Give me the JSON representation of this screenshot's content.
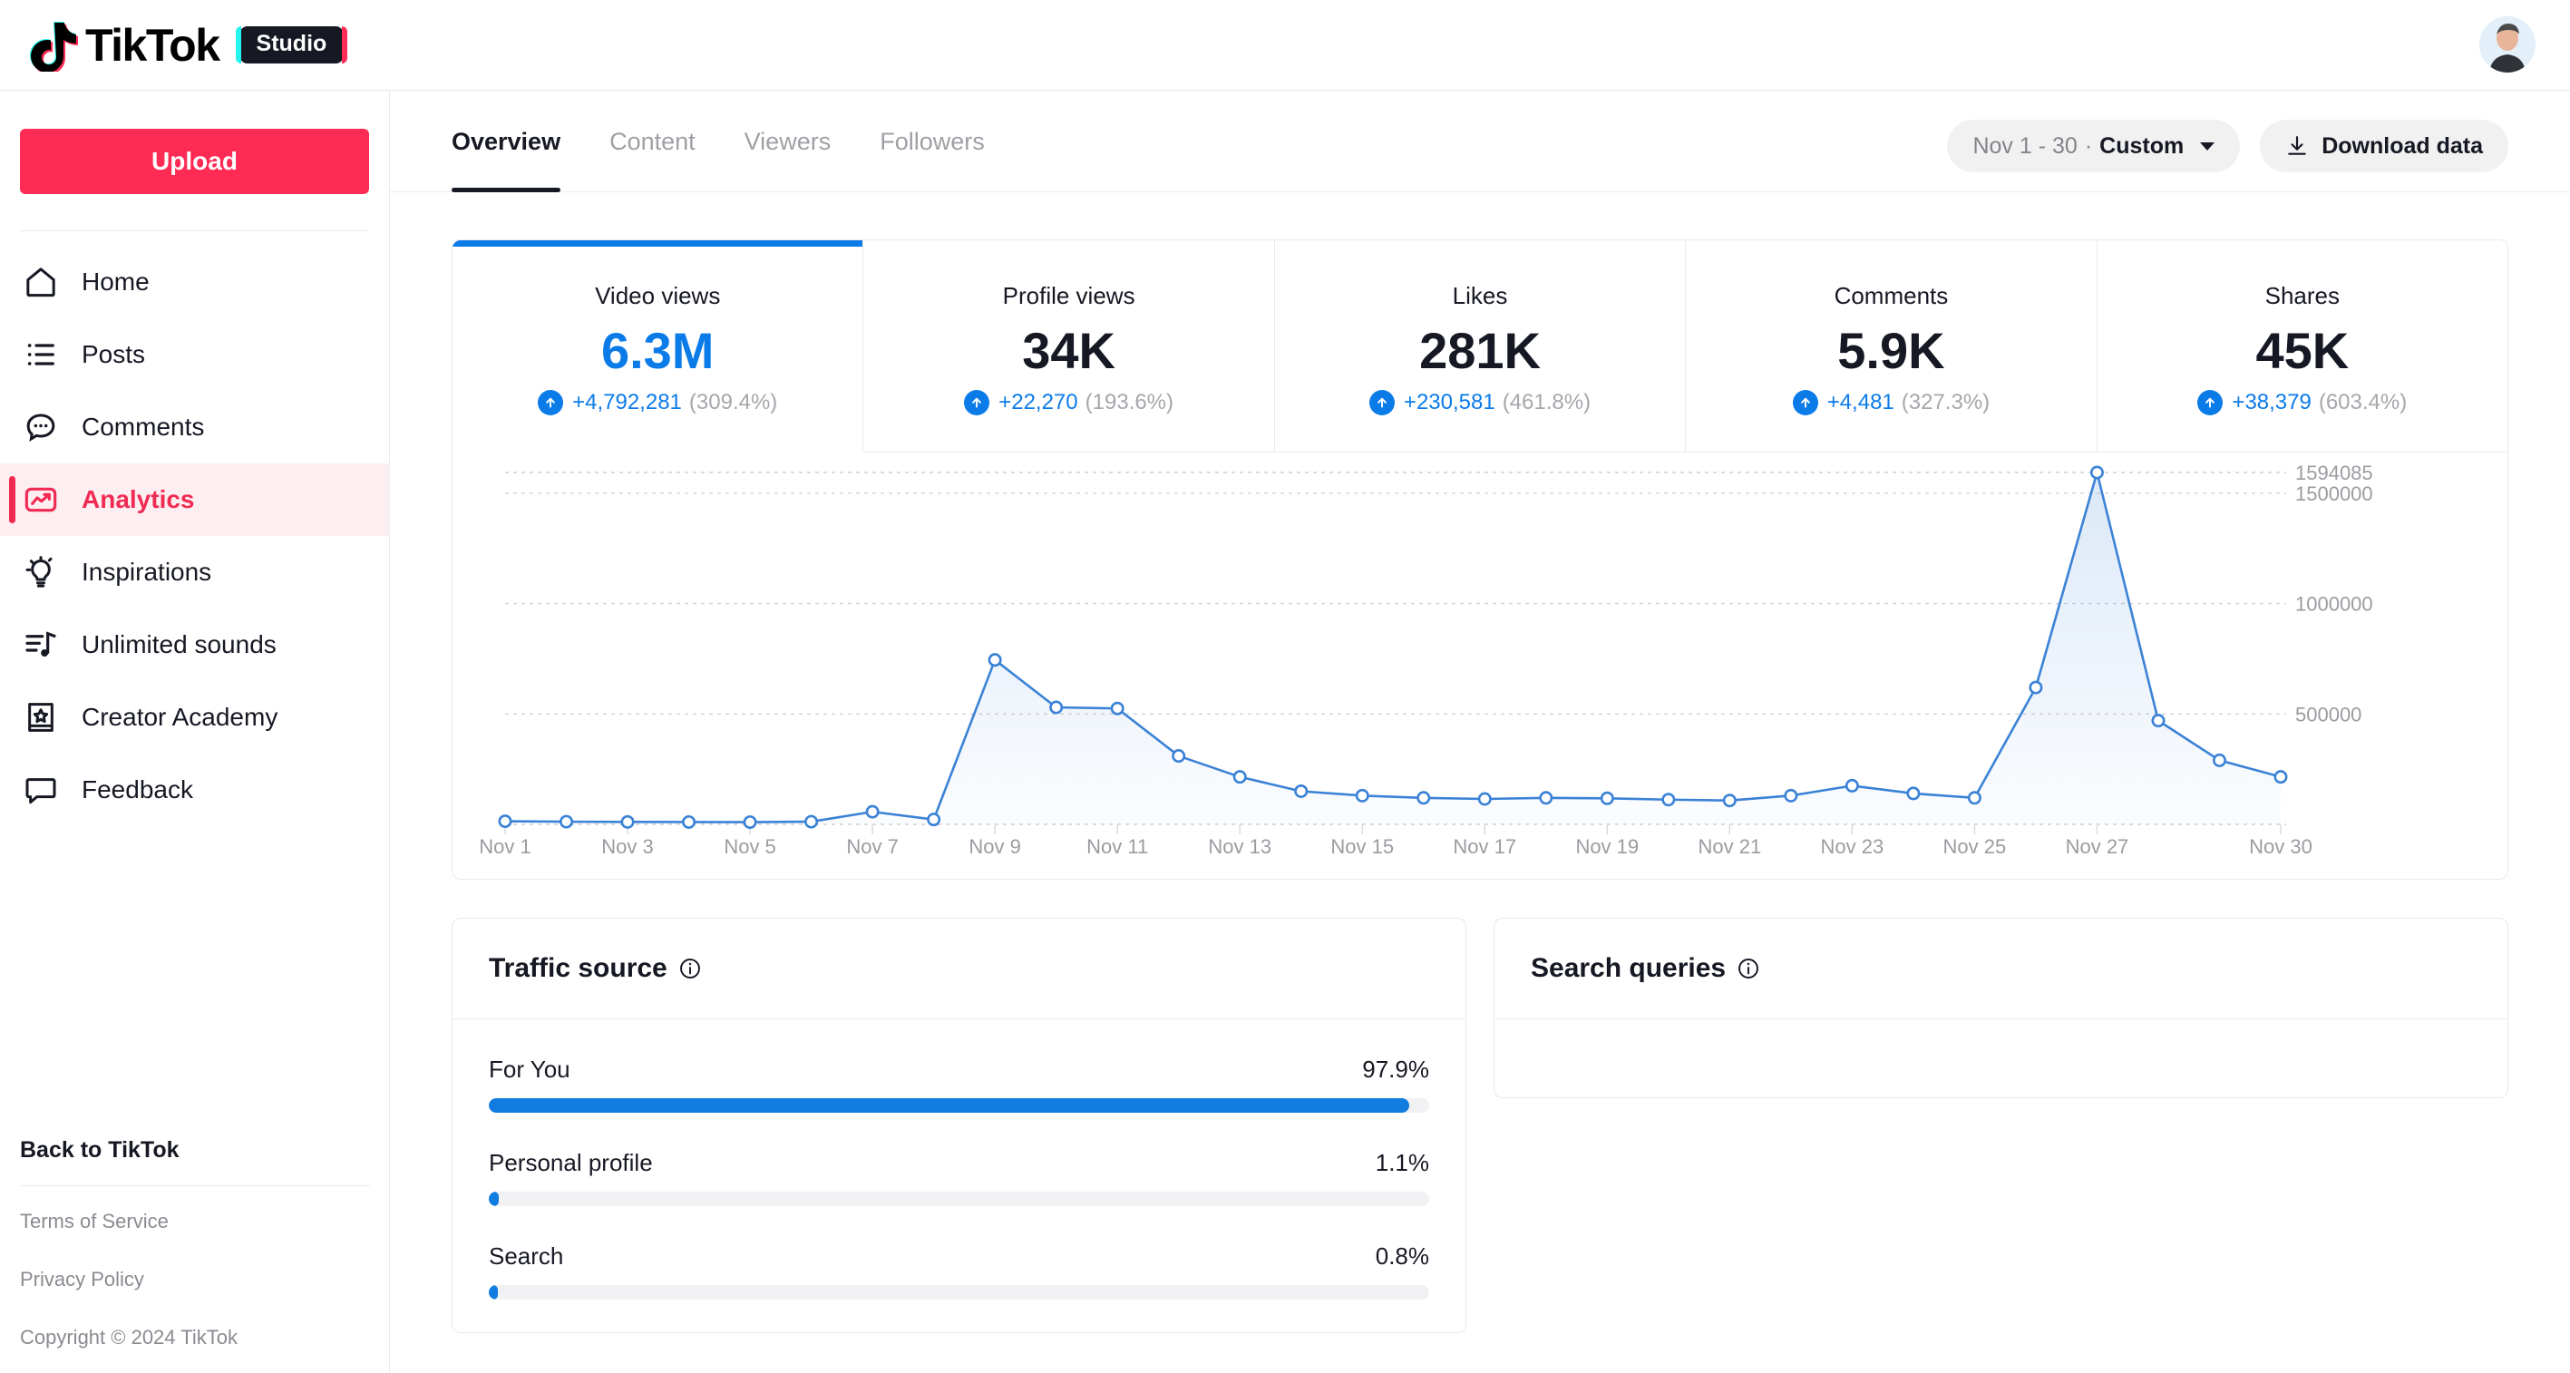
{
  "brand": {
    "wordmark": "TikTok",
    "badge": "Studio",
    "note_icon": "tiktok-note-icon",
    "avatar_icon": "user-avatar"
  },
  "sidebar": {
    "upload_label": "Upload",
    "items": [
      {
        "label": "Home",
        "icon": "home-icon",
        "active": false
      },
      {
        "label": "Posts",
        "icon": "list-icon",
        "active": false
      },
      {
        "label": "Comments",
        "icon": "comment-bubble-icon",
        "active": false
      },
      {
        "label": "Analytics",
        "icon": "analytics-chart-icon",
        "active": true
      },
      {
        "label": "Inspirations",
        "icon": "lightbulb-icon",
        "active": false
      },
      {
        "label": "Unlimited sounds",
        "icon": "music-note-icon",
        "active": false
      },
      {
        "label": "Creator Academy",
        "icon": "book-star-icon",
        "active": false
      },
      {
        "label": "Feedback",
        "icon": "feedback-bubble-icon",
        "active": false
      }
    ],
    "back_label": "Back to TikTok",
    "footer_links": [
      "Terms of Service",
      "Privacy Policy"
    ],
    "copyright": "Copyright © 2024 TikTok"
  },
  "tabs": [
    {
      "label": "Overview",
      "active": true
    },
    {
      "label": "Content",
      "active": false
    },
    {
      "label": "Viewers",
      "active": false
    },
    {
      "label": "Followers",
      "active": false
    }
  ],
  "toolbar": {
    "range_dates": "Nov 1 - 30",
    "range_sep": "·",
    "range_mode": "Custom",
    "download_label": "Download data",
    "download_icon": "download-icon",
    "caret_icon": "chevron-down-icon"
  },
  "metrics": [
    {
      "label": "Video views",
      "value": "6.3M",
      "delta": "+4,792,281",
      "pct": "(309.4%)",
      "selected": true
    },
    {
      "label": "Profile views",
      "value": "34K",
      "delta": "+22,270",
      "pct": "(193.6%)",
      "selected": false
    },
    {
      "label": "Likes",
      "value": "281K",
      "delta": "+230,581",
      "pct": "(461.8%)",
      "selected": false
    },
    {
      "label": "Comments",
      "value": "5.9K",
      "delta": "+4,481",
      "pct": "(327.3%)",
      "selected": false
    },
    {
      "label": "Shares",
      "value": "45K",
      "delta": "+38,379",
      "pct": "(603.4%)",
      "selected": false
    }
  ],
  "chart_data": {
    "type": "line",
    "title": "Video views",
    "xlabel": "",
    "ylabel": "",
    "grid": true,
    "legend": "none",
    "ylim": [
      0,
      1594085
    ],
    "ytick_labels": [
      "1594085",
      "1500000",
      "1000000",
      "500000"
    ],
    "yticks": [
      1594085,
      1500000,
      1000000,
      500000
    ],
    "xtick_labels": [
      "Nov 1",
      "Nov 3",
      "Nov 5",
      "Nov 7",
      "Nov 9",
      "Nov 11",
      "Nov 13",
      "Nov 15",
      "Nov 17",
      "Nov 19",
      "Nov 21",
      "Nov 23",
      "Nov 25",
      "Nov 27",
      "Nov 30"
    ],
    "x": [
      "Nov 1",
      "Nov 2",
      "Nov 3",
      "Nov 4",
      "Nov 5",
      "Nov 6",
      "Nov 7",
      "Nov 8",
      "Nov 9",
      "Nov 10",
      "Nov 11",
      "Nov 12",
      "Nov 13",
      "Nov 14",
      "Nov 15",
      "Nov 16",
      "Nov 17",
      "Nov 18",
      "Nov 19",
      "Nov 20",
      "Nov 21",
      "Nov 22",
      "Nov 23",
      "Nov 24",
      "Nov 25",
      "Nov 26",
      "Nov 27",
      "Nov 28",
      "Nov 29",
      "Nov 30"
    ],
    "values": [
      14000,
      12000,
      11000,
      10500,
      10000,
      12000,
      57000,
      22000,
      745000,
      530000,
      525000,
      310000,
      215000,
      150000,
      130000,
      120000,
      115000,
      120000,
      118000,
      112000,
      108000,
      130000,
      175000,
      140000,
      120000,
      620000,
      1594085,
      470000,
      290000,
      215000
    ],
    "series_color": "#3b82d6",
    "area_fill": "#eaf2fc"
  },
  "traffic": {
    "title": "Traffic source",
    "info_icon": "info-icon",
    "rows": [
      {
        "name": "For You",
        "pct": "97.9%",
        "value": 97.9
      },
      {
        "name": "Personal profile",
        "pct": "1.1%",
        "value": 1.1
      },
      {
        "name": "Search",
        "pct": "0.8%",
        "value": 0.8
      }
    ]
  },
  "search_queries": {
    "title": "Search queries",
    "info_icon": "info-icon"
  },
  "colors": {
    "brand_red": "#fe2c55",
    "accent_blue": "#0b7be8",
    "cyan": "#25f4ee"
  }
}
